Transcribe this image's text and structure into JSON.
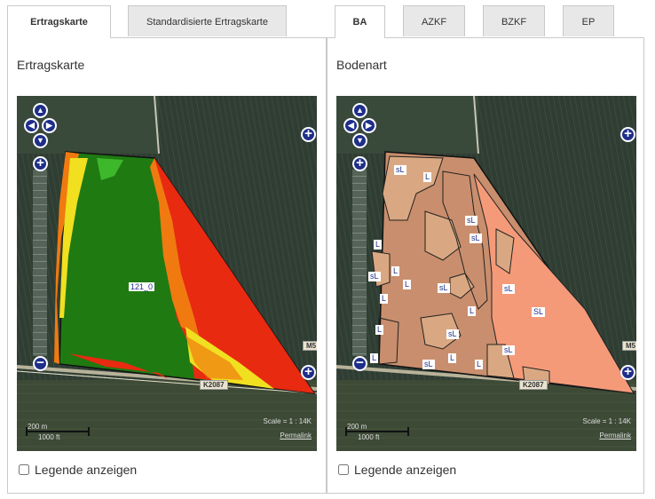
{
  "left_tabs": [
    {
      "label": "Ertragskarte",
      "active": true
    },
    {
      "label": "Standardisierte Ertragskarte",
      "active": false
    }
  ],
  "right_tabs": [
    {
      "label": "BA",
      "active": true
    },
    {
      "label": "AZKF",
      "active": false
    },
    {
      "label": "BZKF",
      "active": false
    },
    {
      "label": "EP",
      "active": false
    }
  ],
  "left_panel": {
    "title": "Ertragskarte",
    "legend_label": "Legende anzeigen",
    "field_label": "121_0"
  },
  "right_panel": {
    "title": "Bodenart",
    "legend_label": "Legende anzeigen"
  },
  "map_common": {
    "road_label_1": "K2087",
    "road_label_2": "M5",
    "scale_m": "200 m",
    "scale_ft": "1000 ft",
    "scale_text": "Scale = 1 : 14K",
    "permalink": "Permalink",
    "nav_up": "▲",
    "nav_down": "▼",
    "nav_left": "◀",
    "nav_right": "▶",
    "zoom_in": "+",
    "zoom_out": "−",
    "expand": "+"
  },
  "soil_labels": [
    "sL",
    "L",
    "sL",
    "L",
    "sL",
    "L",
    "L",
    "sL",
    "L",
    "sL",
    "sL",
    "L",
    "SL",
    "L",
    "sL",
    "L",
    "sL",
    "L",
    "L",
    "sL"
  ],
  "colors": {
    "high": "#1f7a12",
    "good": "#3cb82a",
    "medium": "#f0e020",
    "low": "#f07a10",
    "verylow": "#e82a10",
    "soil_L": "#c98e6d",
    "soil_sL": "#d9a882",
    "soil_SL": "#f59a79"
  }
}
